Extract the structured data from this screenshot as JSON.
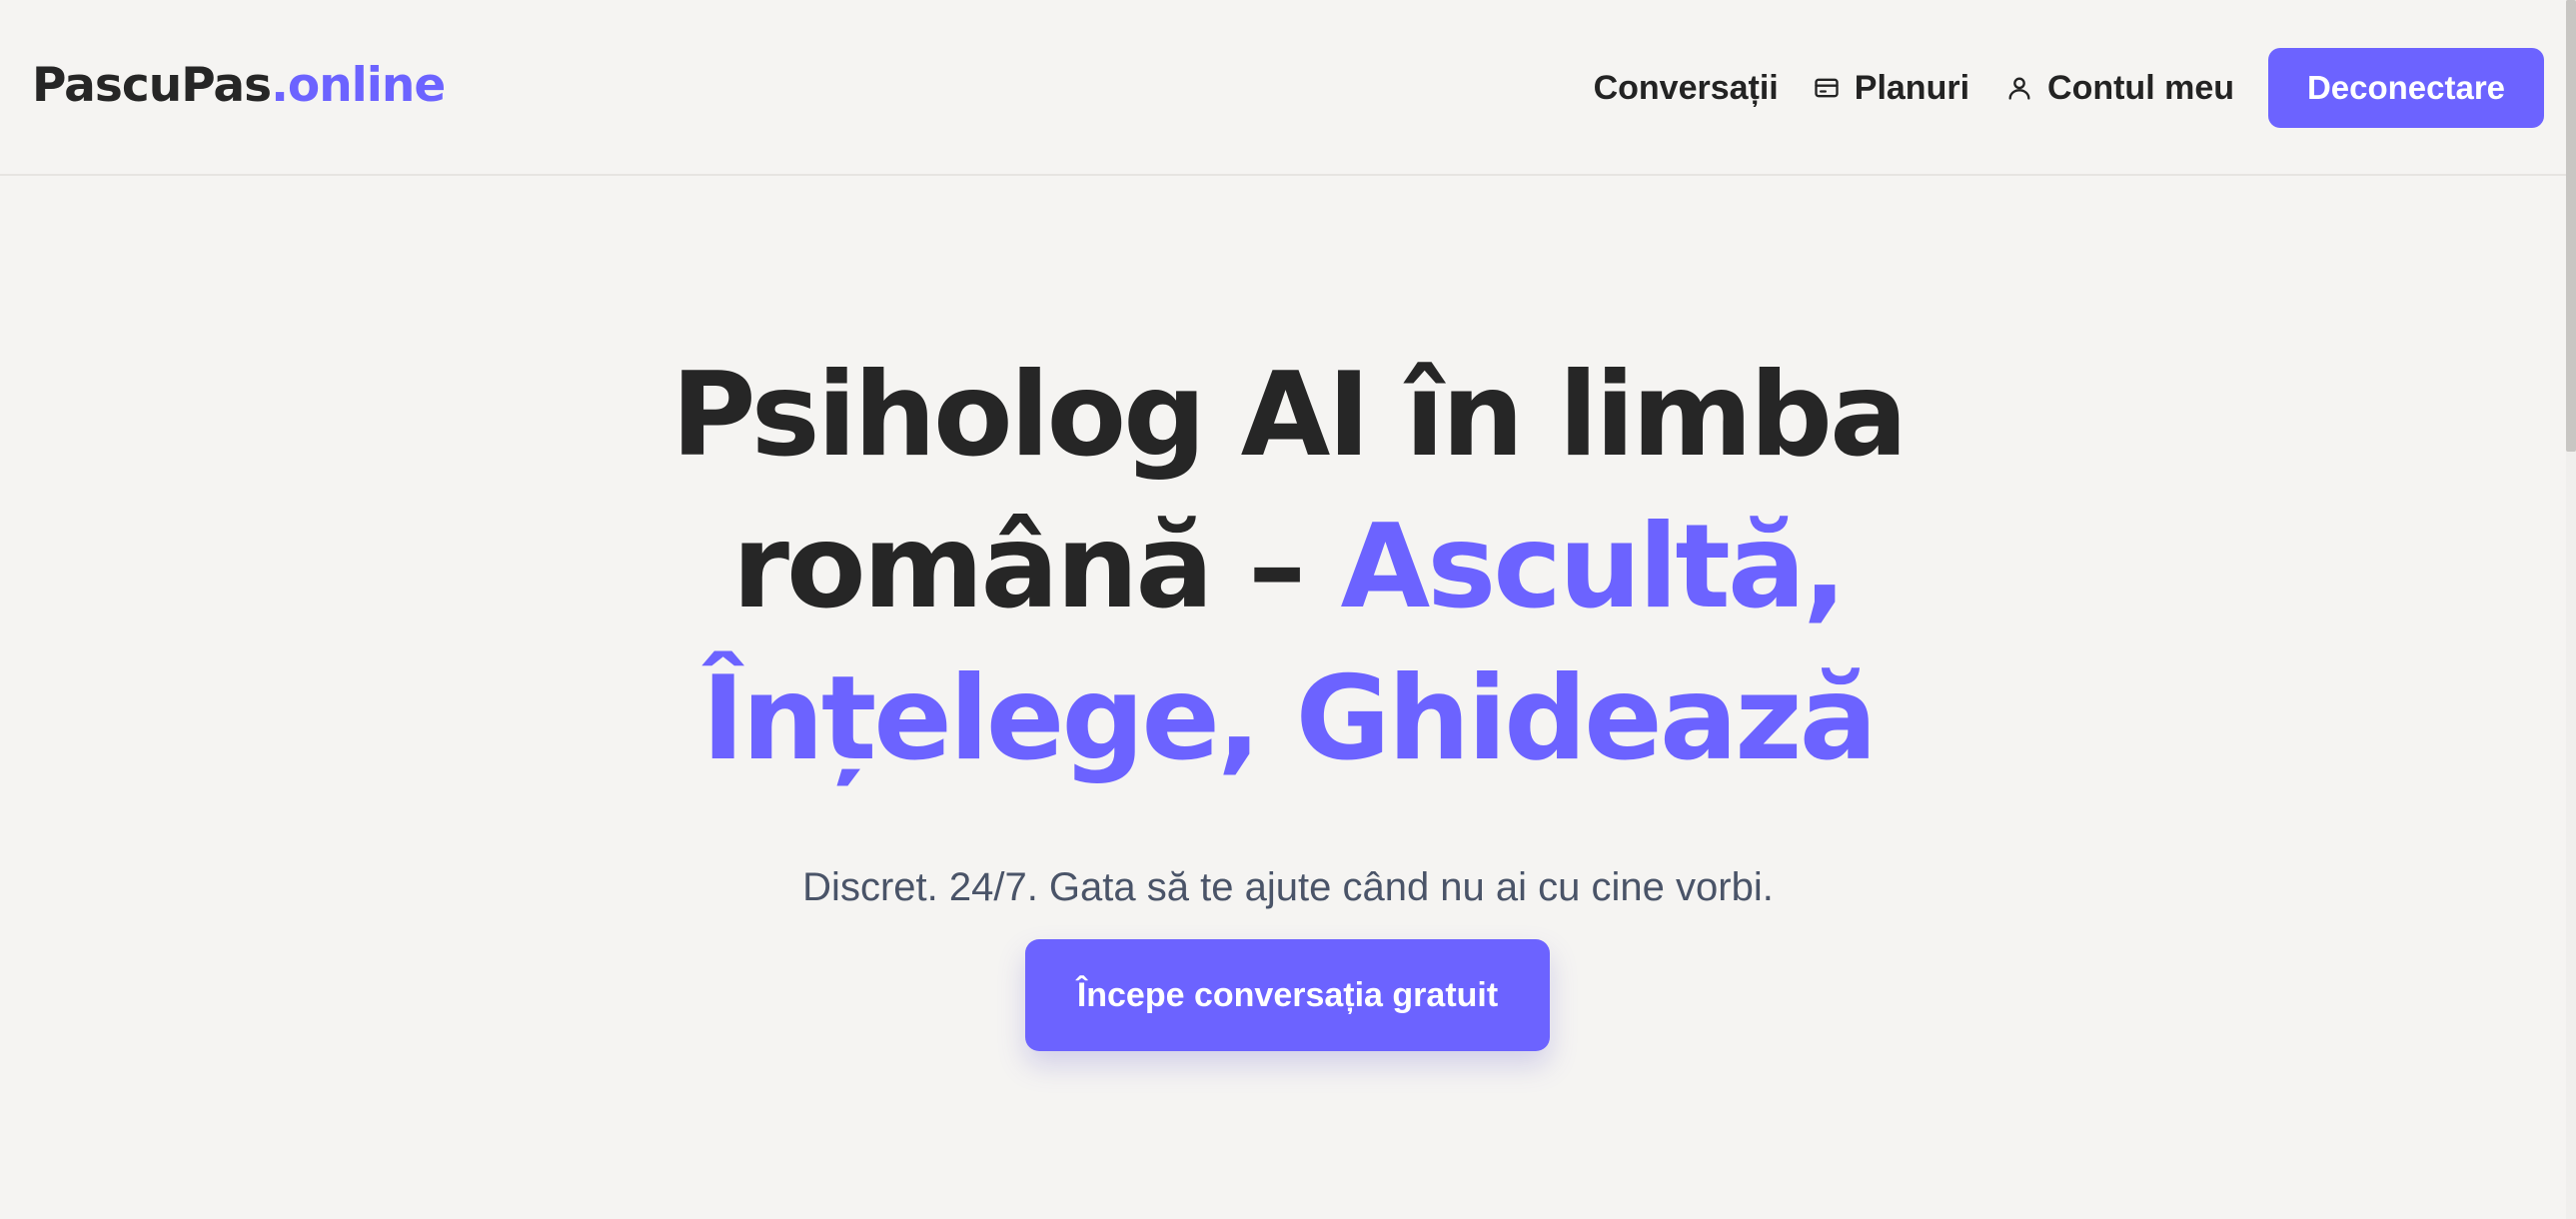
{
  "brand": {
    "name": "PascuPas",
    "tld": ".online",
    "accent_color": "#6c63ff"
  },
  "nav": {
    "conversations": "Conversații",
    "plans": "Planuri",
    "plans_icon": "credit-card-icon",
    "account": "Contul meu",
    "account_icon": "user-icon",
    "logout": "Deconectare"
  },
  "hero": {
    "title_part1": "Psiholog AI în limba română – ",
    "title_highlight": "Ascultă, Înțelege, Ghidează",
    "subtitle": "Discret. 24/7. Gata să te ajute când nu ai cu cine vorbi.",
    "cta": "Începe conversația gratuit"
  }
}
